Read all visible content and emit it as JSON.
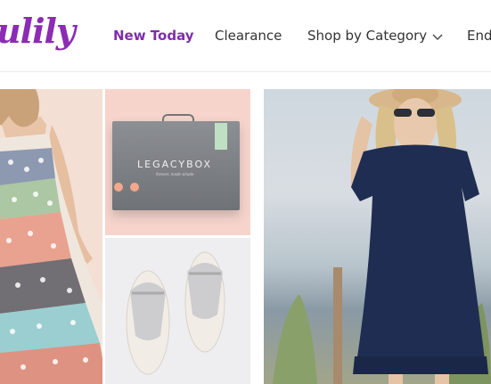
{
  "brand": {
    "logo_text": "ulily",
    "accent": "#7d2ea8"
  },
  "nav": {
    "items": [
      {
        "label": "New Today",
        "active": true
      },
      {
        "label": "Clearance",
        "active": false
      },
      {
        "label": "Shop by Category",
        "active": false,
        "icon": "chevron-down-icon"
      },
      {
        "label": "Ends",
        "active": false
      }
    ]
  },
  "products": [
    {
      "name": "floral-tiered-dress"
    },
    {
      "name": "legacybox-kit",
      "box_title": "LEGACYBOX",
      "box_tagline": "forever, made simple"
    },
    {
      "name": "silver-sandals"
    },
    {
      "name": "navy-shift-dress"
    }
  ]
}
